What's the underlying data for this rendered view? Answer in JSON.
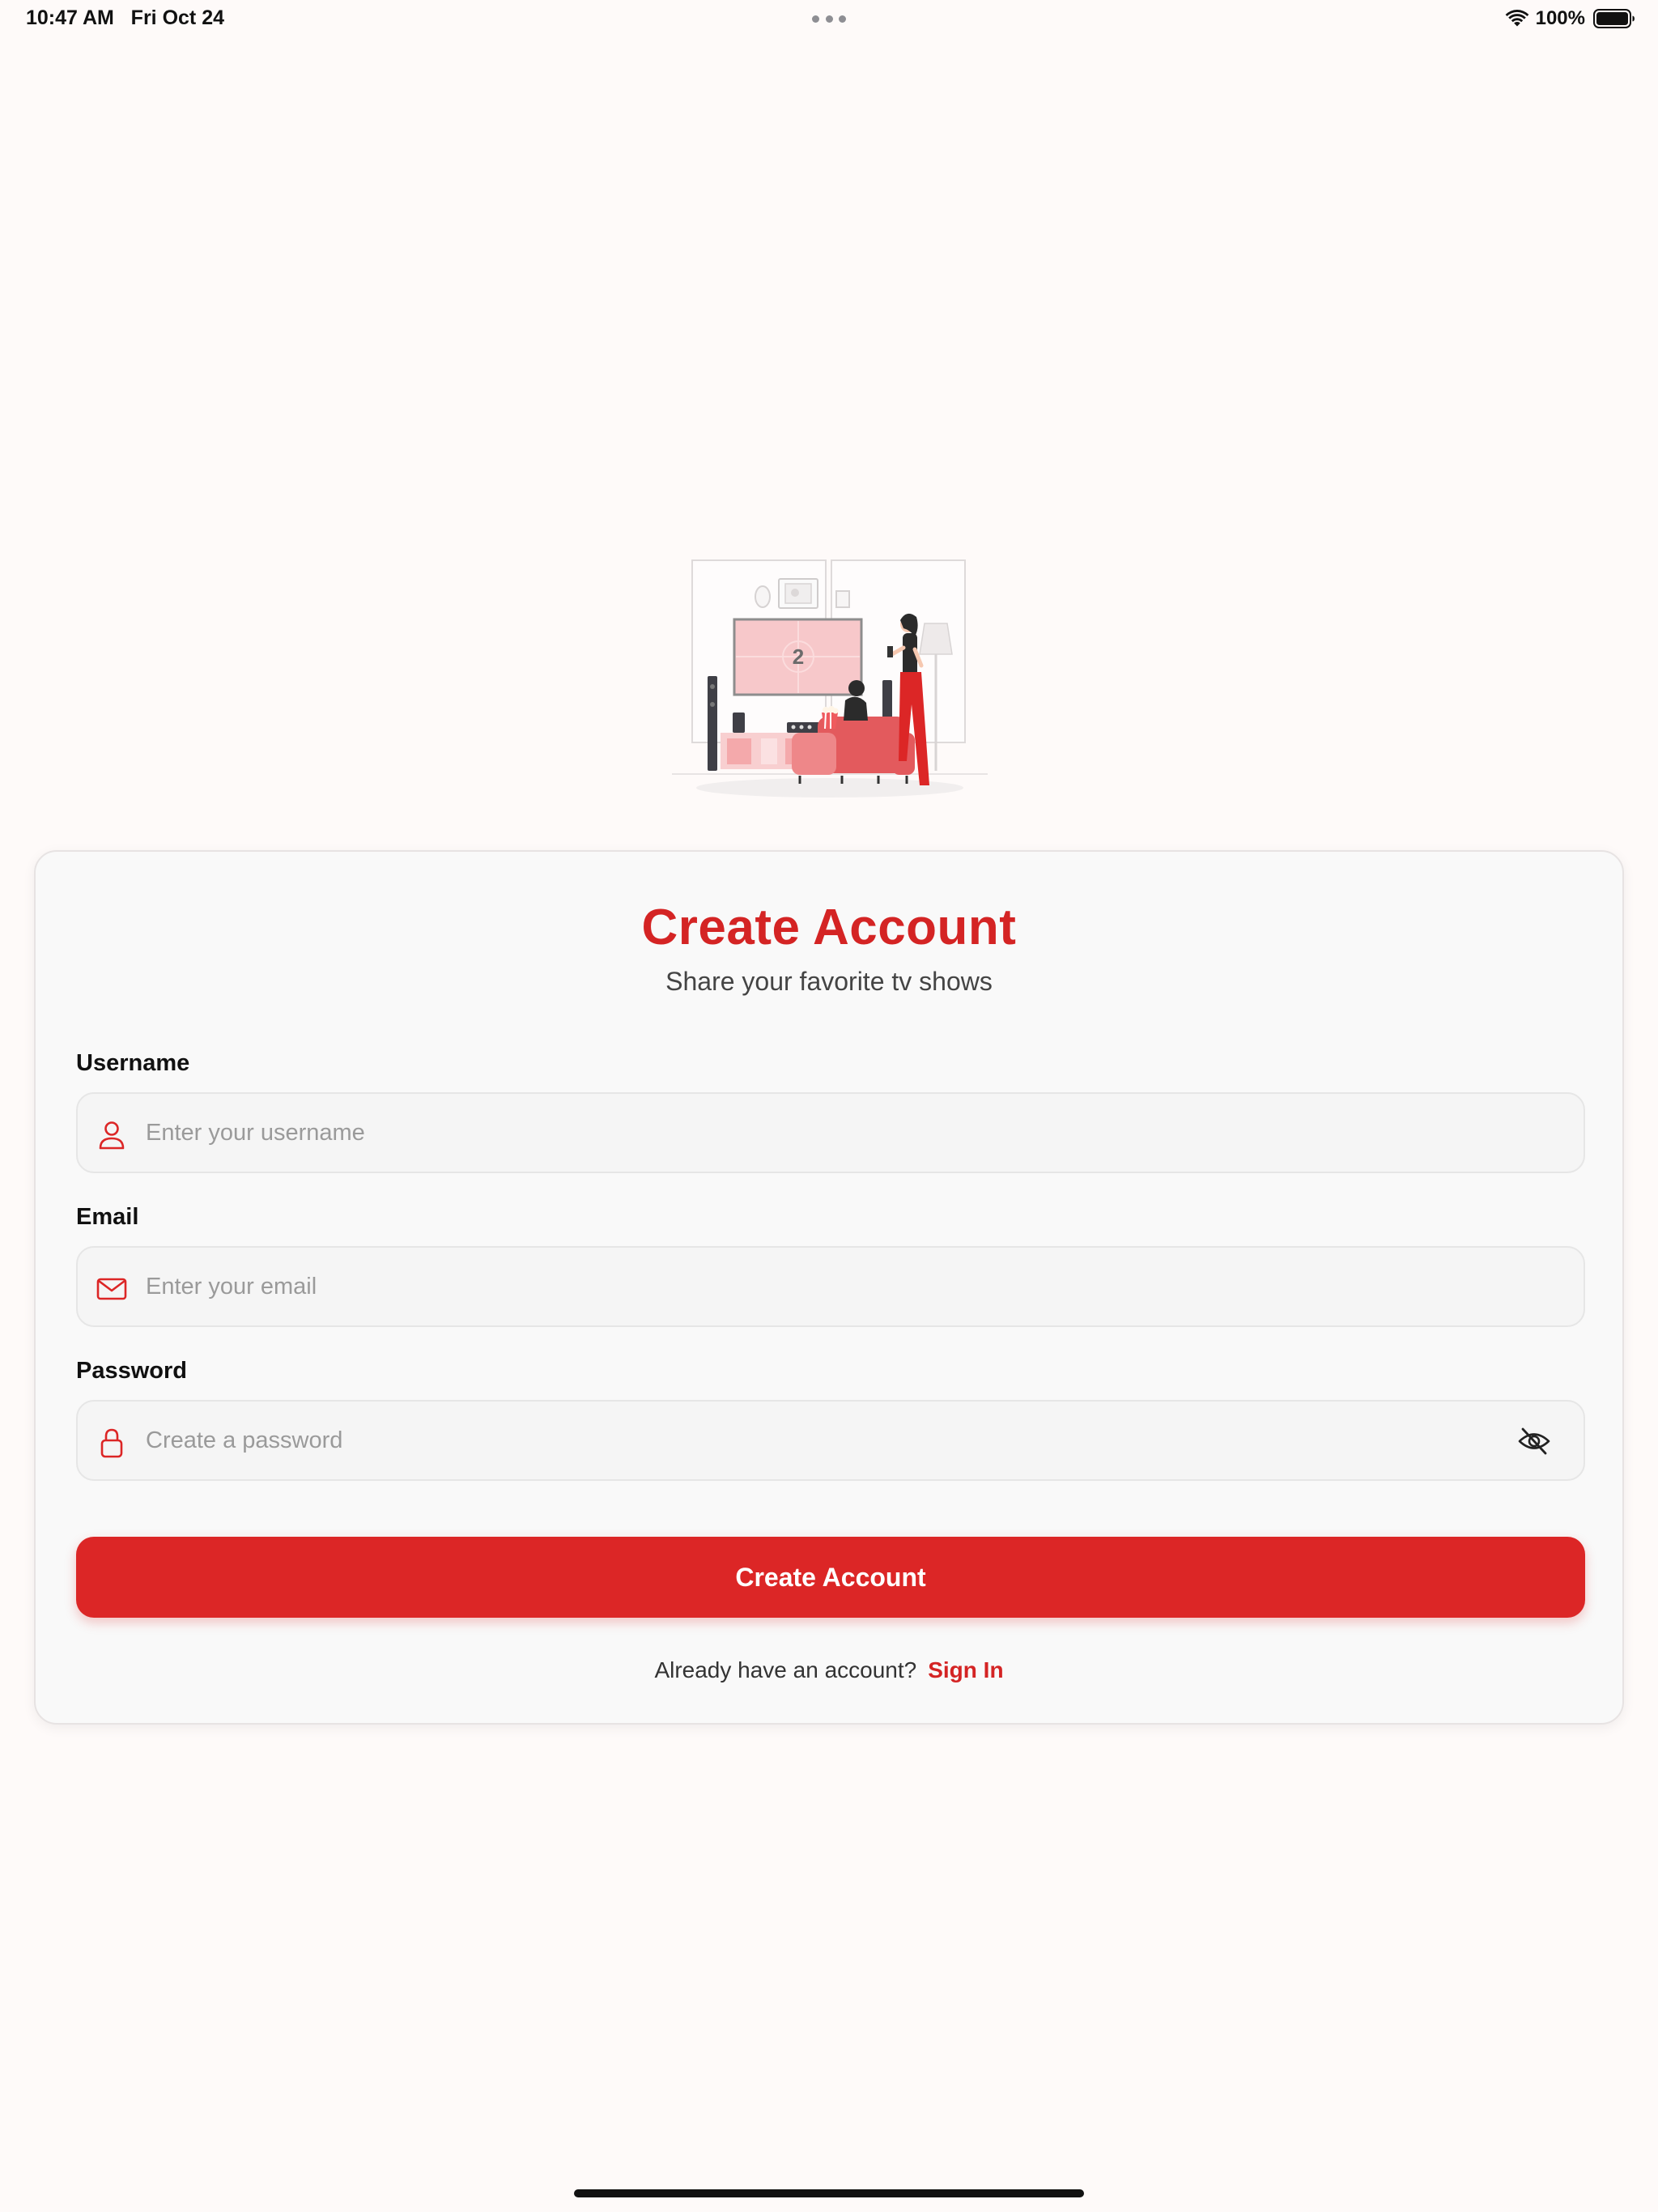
{
  "status_bar": {
    "time": "10:47 AM   Fri Oct 24",
    "battery": "100%"
  },
  "illustration": {
    "tv_number": "2"
  },
  "card": {
    "title": "Create Account",
    "subtitle": "Share your favorite tv shows"
  },
  "form": {
    "username": {
      "label": "Username",
      "placeholder": "Enter your username",
      "icon": "user-icon"
    },
    "email": {
      "label": "Email",
      "placeholder": "Enter your email",
      "icon": "mail-icon"
    },
    "password": {
      "label": "Password",
      "placeholder": "Create a password",
      "icon": "lock-icon",
      "toggle_icon": "eye-off-icon"
    },
    "submit_label": "Create Account"
  },
  "footer": {
    "prompt": "Already have an account?",
    "link": "Sign In"
  },
  "colors": {
    "accent": "#dc2626",
    "title": "#d42424",
    "background": "#fefaf9",
    "card": "#f9f9f9"
  }
}
